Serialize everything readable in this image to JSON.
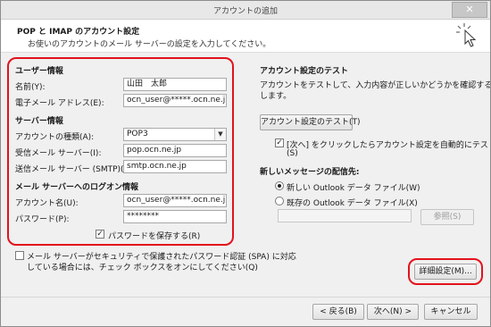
{
  "window": {
    "title": "アカウントの追加",
    "close_label": "✕"
  },
  "header": {
    "title": "POP と IMAP のアカウント設定",
    "subtitle": "お使いのアカウントのメール サーバーの設定を入力してください。"
  },
  "user_info": {
    "heading": "ユーザー情報",
    "name_label": "名前(Y):",
    "name_value": "山田　太郎",
    "email_label": "電子メール アドレス(E):",
    "email_value": "ocn_user@*****.ocn.ne.jp"
  },
  "server_info": {
    "heading": "サーバー情報",
    "account_type_label": "アカウントの種類(A):",
    "account_type_value": "POP3",
    "incoming_label": "受信メール サーバー(I):",
    "incoming_value": "pop.ocn.ne.jp",
    "outgoing_label": "送信メール サーバー (SMTP)(O):",
    "outgoing_value": "smtp.ocn.ne.jp"
  },
  "logon_info": {
    "heading": "メール サーバーへのログオン情報",
    "account_label": "アカウント名(U):",
    "account_value": "ocn_user@*****.ocn.ne.jp",
    "password_label": "パスワード(P):",
    "password_value": "********",
    "remember_label": "パスワードを保存する(R)",
    "remember_checked": true
  },
  "spa": {
    "label_line1": "メール サーバーがセキュリティで保護されたパスワード認証 (SPA) に対応",
    "label_line2": "している場合には、チェック ボックスをオンにしてください(Q)",
    "checked": false
  },
  "test": {
    "heading": "アカウント設定のテスト",
    "description_line1": "アカウントをテストして、入力内容が正しいかどうかを確認することをお勧め",
    "description_line2": "します。",
    "button_label": "アカウント設定のテスト(T)",
    "auto_test_line1": "[次へ] をクリックしたらアカウント設定を自動的にテストする",
    "auto_test_line2": "(S)",
    "auto_test_checked": true
  },
  "delivery": {
    "heading": "新しいメッセージの配信先:",
    "option_new": "新しい Outlook データ ファイル(W)",
    "option_existing": "既存の Outlook データ ファイル(X)",
    "browse_label": "参照(S)"
  },
  "buttons": {
    "more_settings": "詳細設定(M)...",
    "back": "< 戻る(B)",
    "next": "次へ(N) >",
    "cancel": "キャンセル"
  },
  "colors": {
    "highlight": "#e3121c"
  }
}
